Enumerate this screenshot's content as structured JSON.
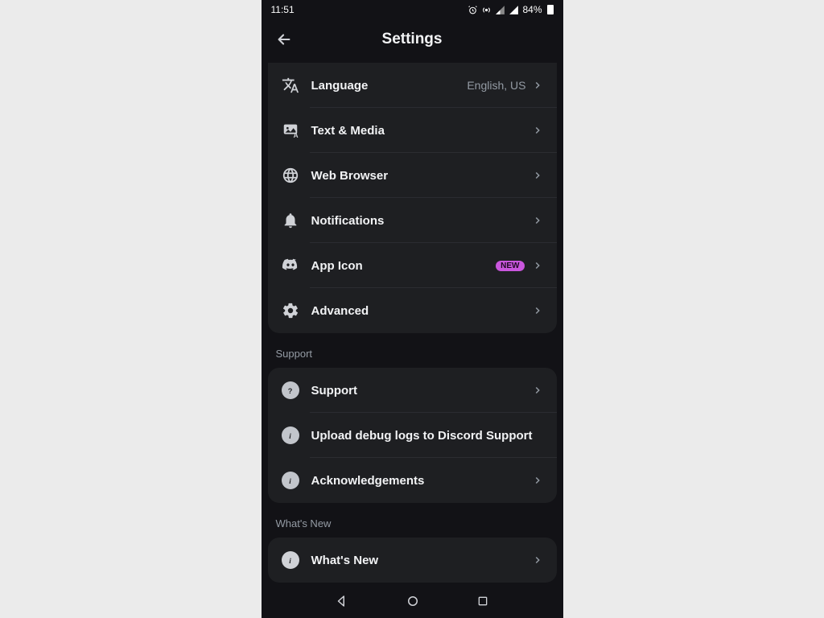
{
  "status": {
    "time": "11:51",
    "battery_pct": "84%"
  },
  "header": {
    "title": "Settings"
  },
  "sections": [
    {
      "rows": [
        {
          "icon": "language-icon",
          "label": "Language",
          "value": "English, US"
        },
        {
          "icon": "text-media-icon",
          "label": "Text & Media"
        },
        {
          "icon": "web-browser-icon",
          "label": "Web Browser"
        },
        {
          "icon": "notifications-icon",
          "label": "Notifications"
        },
        {
          "icon": "app-icon-icon",
          "label": "App Icon",
          "badge": "NEW"
        },
        {
          "icon": "advanced-icon",
          "label": "Advanced"
        }
      ]
    },
    {
      "title": "Support",
      "rows": [
        {
          "icon": "support-icon",
          "label": "Support"
        },
        {
          "icon": "upload-logs-icon",
          "label": "Upload debug logs to Discord Support",
          "no_chevron": true
        },
        {
          "icon": "acknowledgements-icon",
          "label": "Acknowledgements"
        }
      ]
    },
    {
      "title": "What's New",
      "rows": [
        {
          "icon": "whats-new-icon",
          "label": "What's New"
        }
      ]
    }
  ]
}
